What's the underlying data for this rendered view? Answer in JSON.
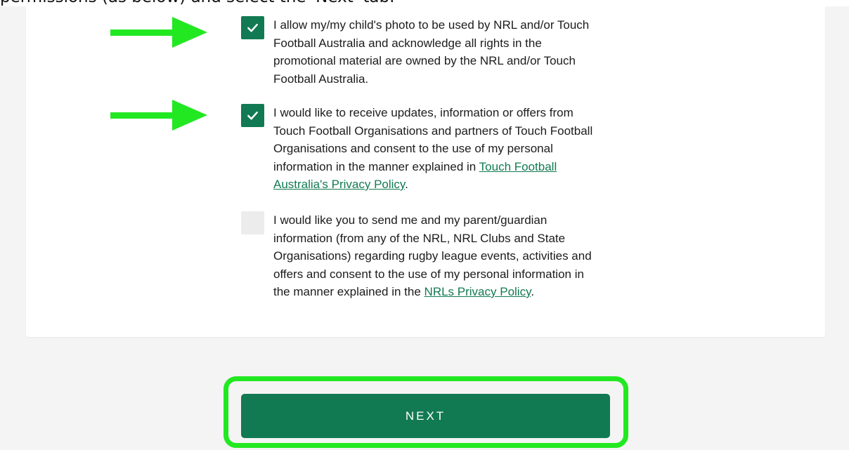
{
  "caption": {
    "text": "permissions (as below) and select the 'Next' tab."
  },
  "colors": {
    "accent": "#127a52",
    "highlight": "#22e822",
    "unchecked": "#ececec"
  },
  "options": [
    {
      "checked": true,
      "text": "I allow my/my child's photo to be used by NRL and/or Touch Football Australia and acknowledge all rights in the promotional material are owned by the NRL and/or Touch Football Australia."
    },
    {
      "checked": true,
      "text": "I would like to receive updates, information or offers from Touch Football Organisations and partners of Touch Football Organisations and consent to the use of my personal information in the manner explained in ",
      "link": "Touch Football Australia's Privacy Policy",
      "suffix": "."
    },
    {
      "checked": false,
      "text": "I would like you to send me and my parent/guardian information (from any of the NRL, NRL Clubs and State Organisations) regarding rugby league events, activities and offers and consent to the use of my personal information in the manner explained in the ",
      "link": "NRLs Privacy Policy",
      "suffix": "."
    }
  ],
  "next_button": {
    "label": "NEXT"
  },
  "annotations": {
    "arrow_icon": "right-arrow-icon",
    "outline": "highlight-outline"
  }
}
